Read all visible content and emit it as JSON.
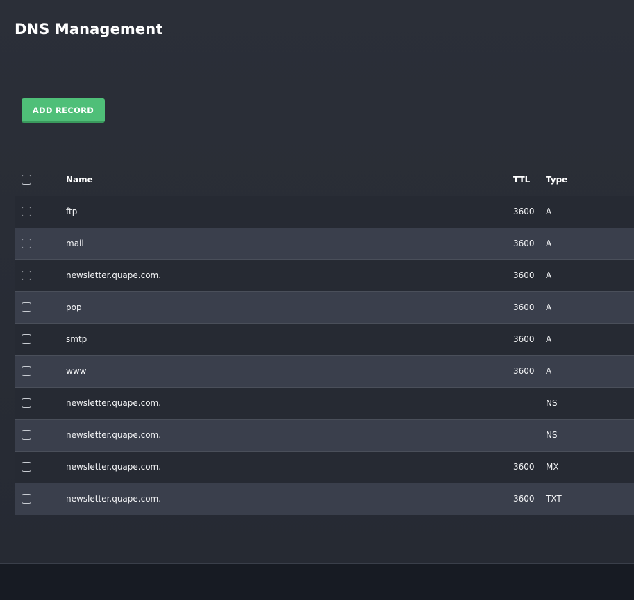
{
  "page": {
    "title": "DNS Management"
  },
  "toolbar": {
    "add_record_label": "ADD RECORD"
  },
  "table": {
    "headers": {
      "name": "Name",
      "ttl": "TTL",
      "type": "Type"
    },
    "rows": [
      {
        "name": "ftp",
        "ttl": "3600",
        "type": "A"
      },
      {
        "name": "mail",
        "ttl": "3600",
        "type": "A"
      },
      {
        "name": "newsletter.quape.com.",
        "ttl": "3600",
        "type": "A"
      },
      {
        "name": "pop",
        "ttl": "3600",
        "type": "A"
      },
      {
        "name": "smtp",
        "ttl": "3600",
        "type": "A"
      },
      {
        "name": "www",
        "ttl": "3600",
        "type": "A"
      },
      {
        "name": "newsletter.quape.com.",
        "ttl": "",
        "type": "NS"
      },
      {
        "name": "newsletter.quape.com.",
        "ttl": "",
        "type": "NS"
      },
      {
        "name": "newsletter.quape.com.",
        "ttl": "3600",
        "type": "MX"
      },
      {
        "name": "newsletter.quape.com.",
        "ttl": "3600",
        "type": "TXT"
      }
    ]
  },
  "colors": {
    "background": "#262a33",
    "row_alt": "#3a3f4c",
    "accent_green": "#4fbf78",
    "footer": "#171b23"
  }
}
